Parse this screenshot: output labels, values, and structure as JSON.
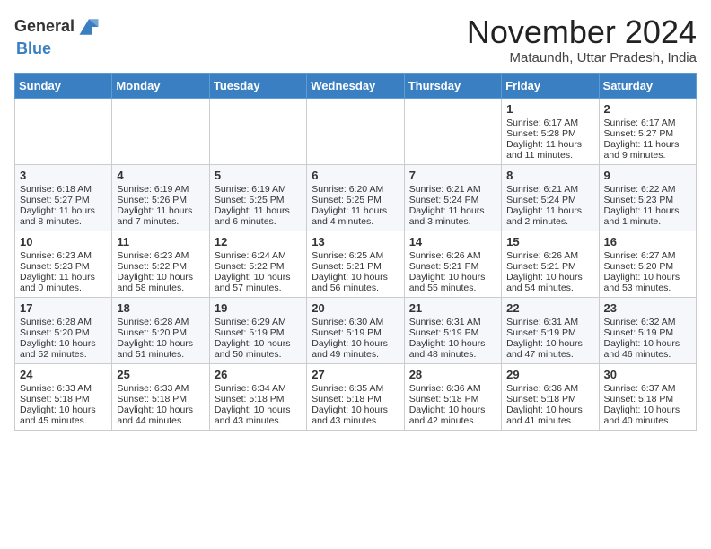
{
  "header": {
    "logo_line1": "General",
    "logo_line2": "Blue",
    "month_title": "November 2024",
    "location": "Mataundh, Uttar Pradesh, India"
  },
  "weekdays": [
    "Sunday",
    "Monday",
    "Tuesday",
    "Wednesday",
    "Thursday",
    "Friday",
    "Saturday"
  ],
  "weeks": [
    [
      {
        "day": "",
        "info": ""
      },
      {
        "day": "",
        "info": ""
      },
      {
        "day": "",
        "info": ""
      },
      {
        "day": "",
        "info": ""
      },
      {
        "day": "",
        "info": ""
      },
      {
        "day": "1",
        "info": "Sunrise: 6:17 AM\nSunset: 5:28 PM\nDaylight: 11 hours and 11 minutes."
      },
      {
        "day": "2",
        "info": "Sunrise: 6:17 AM\nSunset: 5:27 PM\nDaylight: 11 hours and 9 minutes."
      }
    ],
    [
      {
        "day": "3",
        "info": "Sunrise: 6:18 AM\nSunset: 5:27 PM\nDaylight: 11 hours and 8 minutes."
      },
      {
        "day": "4",
        "info": "Sunrise: 6:19 AM\nSunset: 5:26 PM\nDaylight: 11 hours and 7 minutes."
      },
      {
        "day": "5",
        "info": "Sunrise: 6:19 AM\nSunset: 5:25 PM\nDaylight: 11 hours and 6 minutes."
      },
      {
        "day": "6",
        "info": "Sunrise: 6:20 AM\nSunset: 5:25 PM\nDaylight: 11 hours and 4 minutes."
      },
      {
        "day": "7",
        "info": "Sunrise: 6:21 AM\nSunset: 5:24 PM\nDaylight: 11 hours and 3 minutes."
      },
      {
        "day": "8",
        "info": "Sunrise: 6:21 AM\nSunset: 5:24 PM\nDaylight: 11 hours and 2 minutes."
      },
      {
        "day": "9",
        "info": "Sunrise: 6:22 AM\nSunset: 5:23 PM\nDaylight: 11 hours and 1 minute."
      }
    ],
    [
      {
        "day": "10",
        "info": "Sunrise: 6:23 AM\nSunset: 5:23 PM\nDaylight: 11 hours and 0 minutes."
      },
      {
        "day": "11",
        "info": "Sunrise: 6:23 AM\nSunset: 5:22 PM\nDaylight: 10 hours and 58 minutes."
      },
      {
        "day": "12",
        "info": "Sunrise: 6:24 AM\nSunset: 5:22 PM\nDaylight: 10 hours and 57 minutes."
      },
      {
        "day": "13",
        "info": "Sunrise: 6:25 AM\nSunset: 5:21 PM\nDaylight: 10 hours and 56 minutes."
      },
      {
        "day": "14",
        "info": "Sunrise: 6:26 AM\nSunset: 5:21 PM\nDaylight: 10 hours and 55 minutes."
      },
      {
        "day": "15",
        "info": "Sunrise: 6:26 AM\nSunset: 5:21 PM\nDaylight: 10 hours and 54 minutes."
      },
      {
        "day": "16",
        "info": "Sunrise: 6:27 AM\nSunset: 5:20 PM\nDaylight: 10 hours and 53 minutes."
      }
    ],
    [
      {
        "day": "17",
        "info": "Sunrise: 6:28 AM\nSunset: 5:20 PM\nDaylight: 10 hours and 52 minutes."
      },
      {
        "day": "18",
        "info": "Sunrise: 6:28 AM\nSunset: 5:20 PM\nDaylight: 10 hours and 51 minutes."
      },
      {
        "day": "19",
        "info": "Sunrise: 6:29 AM\nSunset: 5:19 PM\nDaylight: 10 hours and 50 minutes."
      },
      {
        "day": "20",
        "info": "Sunrise: 6:30 AM\nSunset: 5:19 PM\nDaylight: 10 hours and 49 minutes."
      },
      {
        "day": "21",
        "info": "Sunrise: 6:31 AM\nSunset: 5:19 PM\nDaylight: 10 hours and 48 minutes."
      },
      {
        "day": "22",
        "info": "Sunrise: 6:31 AM\nSunset: 5:19 PM\nDaylight: 10 hours and 47 minutes."
      },
      {
        "day": "23",
        "info": "Sunrise: 6:32 AM\nSunset: 5:19 PM\nDaylight: 10 hours and 46 minutes."
      }
    ],
    [
      {
        "day": "24",
        "info": "Sunrise: 6:33 AM\nSunset: 5:18 PM\nDaylight: 10 hours and 45 minutes."
      },
      {
        "day": "25",
        "info": "Sunrise: 6:33 AM\nSunset: 5:18 PM\nDaylight: 10 hours and 44 minutes."
      },
      {
        "day": "26",
        "info": "Sunrise: 6:34 AM\nSunset: 5:18 PM\nDaylight: 10 hours and 43 minutes."
      },
      {
        "day": "27",
        "info": "Sunrise: 6:35 AM\nSunset: 5:18 PM\nDaylight: 10 hours and 43 minutes."
      },
      {
        "day": "28",
        "info": "Sunrise: 6:36 AM\nSunset: 5:18 PM\nDaylight: 10 hours and 42 minutes."
      },
      {
        "day": "29",
        "info": "Sunrise: 6:36 AM\nSunset: 5:18 PM\nDaylight: 10 hours and 41 minutes."
      },
      {
        "day": "30",
        "info": "Sunrise: 6:37 AM\nSunset: 5:18 PM\nDaylight: 10 hours and 40 minutes."
      }
    ]
  ]
}
